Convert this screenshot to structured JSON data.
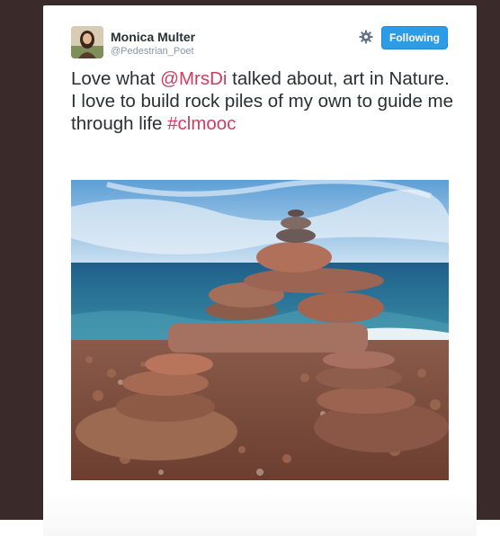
{
  "tweet": {
    "author_name": "Monica Multer",
    "author_handle": "@Pedestrian_Poet",
    "follow_label": "Following",
    "text_before": "Love what ",
    "mention": "@MrsDi",
    "text_middle": " talked about, art in Nature. I love to build rock piles of my own to guide me through life ",
    "hashtag": "#clmooc"
  },
  "icons": {
    "settings": "gear-icon"
  },
  "colors": {
    "link": "#d03d62",
    "follow_button": "#2b9ce6",
    "text": "#292f33",
    "handle": "#8899a6"
  }
}
